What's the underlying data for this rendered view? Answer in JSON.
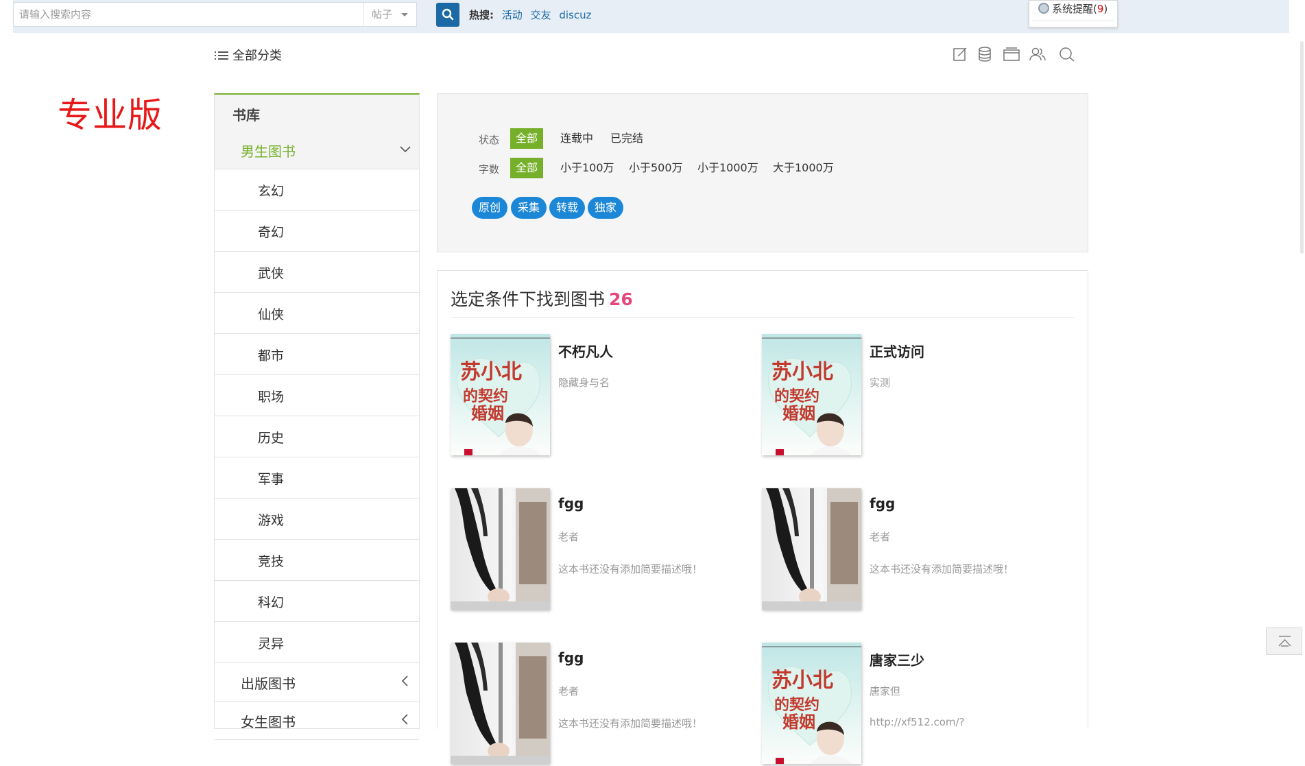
{
  "search": {
    "placeholder": "请输入搜索内容",
    "type_label": "帖子",
    "hot_label": "热搜:",
    "hot_links": [
      "活动",
      "交友",
      "discuz"
    ]
  },
  "notice": {
    "label": "系统提醒(",
    "count": "9",
    "close": ")"
  },
  "nav": {
    "all_categories": "全部分类"
  },
  "brand_text": "专业版",
  "sidebar": {
    "head": "书库",
    "active_category": "男生图书",
    "sub_items": [
      "玄幻",
      "奇幻",
      "武侠",
      "仙侠",
      "都市",
      "职场",
      "历史",
      "军事",
      "游戏",
      "竞技",
      "科幻",
      "灵异"
    ],
    "other_categories": [
      "出版图书",
      "女生图书"
    ]
  },
  "filter": {
    "status_label": "状态",
    "status_options": [
      "全部",
      "连载中",
      "已完结"
    ],
    "words_label": "字数",
    "words_options": [
      "全部",
      "小于100万",
      "小于500万",
      "小于1000万",
      "大于1000万"
    ],
    "tags": [
      "原创",
      "采集",
      "转载",
      "独家"
    ]
  },
  "results": {
    "title": "选定条件下找到图书",
    "count": "26",
    "books": [
      {
        "name": "不朽凡人",
        "author": "隐藏身与名",
        "desc": "",
        "cover": "romance-cover"
      },
      {
        "name": "正式访问",
        "author": "实测",
        "desc": "",
        "cover": "romance-cover"
      },
      {
        "name": "fgg",
        "author": "老者",
        "desc": "这本书还没有添加简要描述哦！",
        "cover": "dancer-cover"
      },
      {
        "name": "fgg",
        "author": "老者",
        "desc": "这本书还没有添加简要描述哦！",
        "cover": "dancer-cover"
      },
      {
        "name": "fgg",
        "author": "老者",
        "desc": "这本书还没有添加简要描述哦！",
        "cover": "dancer-cover"
      },
      {
        "name": "唐家三少",
        "author": "唐家但",
        "desc": "http://xf512.com/?",
        "cover": "romance-cover"
      }
    ],
    "cover_text": "苏小北的契约婚姻"
  },
  "colors": {
    "accent_green": "#76b02b",
    "link_blue": "#1b6aa5",
    "tag_blue": "#1c87d6",
    "count_pink": "#e4477a",
    "brand_red": "#e81818"
  }
}
